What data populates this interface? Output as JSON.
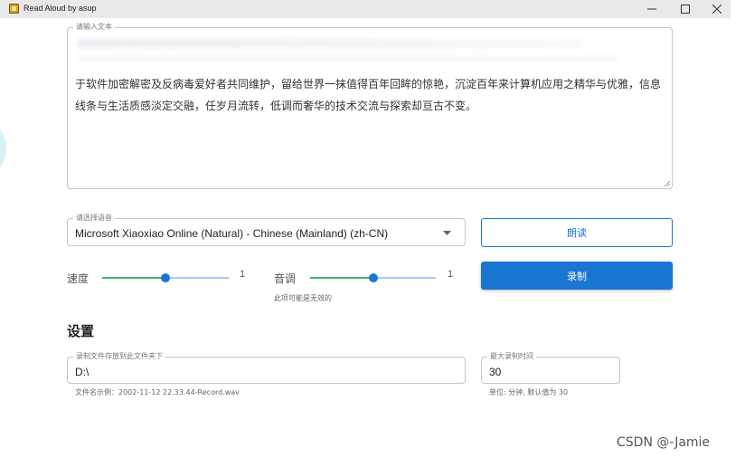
{
  "window": {
    "title": "Read Aloud by asup",
    "controls": {
      "minimize": "minimize-icon",
      "maximize": "maximize-icon",
      "close": "close-icon"
    }
  },
  "text_input": {
    "label": "请输入文本",
    "value": "于软件加密解密及反病毒爱好者共同维护，留给世界一抹值得百年回眸的惊艳，沉淀百年来计算机应用之精华与优雅，信息线条与生活质感淡定交融，任岁月流转，低调而奢华的技术交流与探索却亘古不变。"
  },
  "voice_select": {
    "label": "请选择语音",
    "selected": "Microsoft Xiaoxiao Online (Natural) - Chinese (Mainland) (zh-CN)"
  },
  "buttons": {
    "read": "朗读",
    "record": "录制"
  },
  "speed": {
    "label": "速度",
    "value": "1",
    "fraction": 0.5
  },
  "pitch": {
    "label": "音调",
    "value": "1",
    "fraction": 0.5,
    "helper": "此项可能是无效的"
  },
  "settings": {
    "heading": "设置",
    "folder": {
      "label": "录制文件存放到此文件夹下",
      "value": "D:\\",
      "helper": "文件名示例：2002-11-12 22.33.44-Record.wav"
    },
    "max_time": {
      "label": "最大录制时间",
      "value": "30",
      "helper": "单位: 分钟, 默认值为 30"
    }
  },
  "watermark": "CSDN @-Jamie",
  "colors": {
    "accent": "#1976d2",
    "slider_fill": "#48b06e",
    "slider_track": "#a7c9ec"
  }
}
